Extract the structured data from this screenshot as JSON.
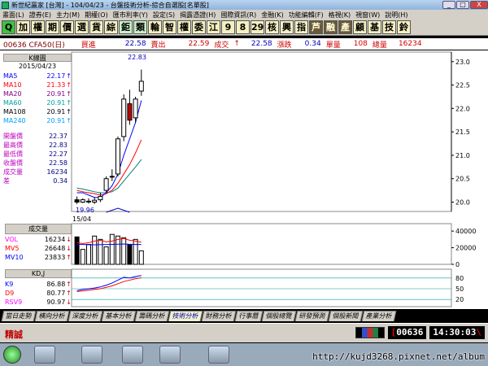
{
  "window": {
    "title": "新世紀贏家 [台灣] - 104/04/23 - 台盤技術分析-綜合自選股[名單股]",
    "min_label": "_",
    "max_label": "□",
    "close_label": "X"
  },
  "menu": [
    "畫面(L)",
    "證券(E)",
    "主力(M)",
    "期權(O)",
    "匯市利率(Y)",
    "設定(S)",
    "揭露憑證(H)",
    "國際資訊(R)",
    "金融(K)",
    "功能編輯(F)",
    "格視(K)",
    "視窗(W)",
    "說明(H)"
  ],
  "toolbar": [
    "加",
    "權",
    "期",
    "價",
    "選",
    "貨",
    "綜",
    "鉅",
    "類",
    "輪",
    "智",
    "權",
    "委",
    "江",
    "9",
    "8",
    "29",
    "核",
    "興",
    "指",
    "芦",
    "融",
    "產",
    "顧",
    "基",
    "技",
    "鈴"
  ],
  "quote": {
    "code": "00636 CFA50(日)",
    "buy_label": "買進",
    "buy": "22.58",
    "sell_label": "賣出",
    "sell": "22.59",
    "trade_label": "成交",
    "trade_arrow": "↑",
    "trade": "22.58",
    "change_label": "漲跌",
    "change": "0.34",
    "volume_label": "單量",
    "volume": "108",
    "total_label": "總量",
    "total": "16234"
  },
  "panel": {
    "header": "K線圖",
    "date": "2015/04/23",
    "ma": [
      {
        "label": "MA5",
        "value": "22.17",
        "arrow": "↑",
        "color": "#0000ff"
      },
      {
        "label": "MA10",
        "value": "21.33",
        "arrow": "↑",
        "color": "#ff0000"
      },
      {
        "label": "MA20",
        "value": "20.91",
        "arrow": "↑",
        "color": "#800080"
      },
      {
        "label": "MA60",
        "value": "20.91",
        "arrow": "↑",
        "color": "#00a0a0"
      },
      {
        "label": "MA108",
        "value": "20.91",
        "arrow": "↑",
        "color": "#000000"
      },
      {
        "label": "MA240",
        "value": "20.91",
        "arrow": "↑",
        "color": "#00a0ff"
      }
    ],
    "stats": [
      {
        "label": "開盤價",
        "value": "22.37"
      },
      {
        "label": "最高價",
        "value": "22.83"
      },
      {
        "label": "最低價",
        "value": "22.27"
      },
      {
        "label": "收盤價",
        "value": "22.58"
      },
      {
        "label": "成交量",
        "value": "16234"
      },
      {
        "label": "差",
        "value": "0.34"
      }
    ]
  },
  "kline": {
    "high_label": "22.83",
    "low_label": "19.96",
    "date_label": "15/04",
    "y_ticks": [
      "23.0",
      "22.5",
      "22.0",
      "21.5",
      "21.0",
      "20.5",
      "20.0"
    ]
  },
  "volume_panel": {
    "header": "成交量",
    "rows": [
      {
        "label": "VOL",
        "value": "16234",
        "arrow": "↓",
        "color": "#ff00ff"
      },
      {
        "label": "MV5",
        "value": "26648",
        "arrow": "↓",
        "color": "#ff0000"
      },
      {
        "label": "MV10",
        "value": "23833",
        "arrow": "↑",
        "color": "#0000ff"
      }
    ],
    "y_ticks": [
      "40000",
      "20000",
      "0"
    ]
  },
  "kd_panel": {
    "header": "KD,J",
    "rows": [
      {
        "label": "K9",
        "value": "86.88",
        "arrow": "↑",
        "color": "#0000ff"
      },
      {
        "label": "D9",
        "value": "80.77",
        "arrow": "↑",
        "color": "#ff0000"
      },
      {
        "label": "RSV9",
        "value": "90.97",
        "arrow": "↓",
        "color": "#ff00ff"
      }
    ],
    "y_ticks": [
      "80",
      "50",
      "20"
    ]
  },
  "tabs": [
    "當日走勢",
    "橫向分析",
    "深度分析",
    "基本分析",
    "籌碼分析",
    "技術分析",
    "財務分析",
    "行事曆",
    "個股總覽",
    "研發預測",
    "個股新聞",
    "產業分析"
  ],
  "active_tab": "技術分析",
  "status": {
    "left": "精誠",
    "code": "00636",
    "time": "14:30:03"
  },
  "watermark": "http://kujd3268.pixnet.net/album",
  "chart_data": {
    "type": "candlestick",
    "candles": [
      {
        "o": 20.05,
        "h": 20.12,
        "l": 19.96,
        "c": 20.0
      },
      {
        "o": 20.0,
        "h": 20.08,
        "l": 19.98,
        "c": 20.05
      },
      {
        "o": 20.02,
        "h": 20.08,
        "l": 19.97,
        "c": 20.02
      },
      {
        "o": 20.0,
        "h": 20.1,
        "l": 19.96,
        "c": 20.04
      },
      {
        "o": 20.05,
        "h": 20.2,
        "l": 20.0,
        "c": 20.12
      },
      {
        "o": 20.25,
        "h": 20.55,
        "l": 20.2,
        "c": 20.5
      },
      {
        "o": 20.55,
        "h": 20.7,
        "l": 20.45,
        "c": 20.55
      },
      {
        "o": 20.6,
        "h": 21.4,
        "l": 20.55,
        "c": 21.35
      },
      {
        "o": 21.4,
        "h": 22.3,
        "l": 21.3,
        "c": 22.2
      },
      {
        "o": 22.1,
        "h": 22.4,
        "l": 21.65,
        "c": 21.75
      },
      {
        "o": 21.8,
        "h": 22.25,
        "l": 21.7,
        "c": 22.2
      },
      {
        "o": 22.37,
        "h": 22.83,
        "l": 22.27,
        "c": 22.58
      }
    ],
    "ma5": [
      20.2,
      20.2,
      20.15,
      20.1,
      20.1,
      20.2,
      20.35,
      20.6,
      21.0,
      21.35,
      21.7,
      22.17
    ],
    "ma10": [
      20.25,
      20.22,
      20.2,
      20.18,
      20.15,
      20.18,
      20.25,
      20.4,
      20.6,
      20.8,
      21.05,
      21.33
    ],
    "ma20": [
      20.3,
      20.28,
      20.25,
      20.22,
      20.2,
      20.2,
      20.22,
      20.3,
      20.45,
      20.6,
      20.75,
      20.91
    ],
    "volume": [
      33000,
      18000,
      24000,
      34000,
      30000,
      21000,
      36000,
      34000,
      32000,
      24000,
      30000,
      16234
    ],
    "mv5": [
      26000,
      25000,
      26000,
      28000,
      29000,
      27000,
      28000,
      30000,
      31000,
      29000,
      28000,
      26648
    ],
    "mv10": [
      24000,
      23800,
      23600,
      23500,
      23700,
      23800,
      24000,
      24200,
      24400,
      24100,
      23900,
      23833
    ],
    "k": [
      45,
      48,
      50,
      52,
      55,
      60,
      66,
      74,
      82,
      80,
      84,
      86.88
    ],
    "d": [
      42,
      44,
      46,
      48,
      50,
      54,
      58,
      64,
      70,
      74,
      78,
      80.77
    ],
    "y_range": [
      19.8,
      23.1
    ],
    "vol_range": [
      0,
      45000
    ],
    "kd_range": [
      0,
      100
    ]
  }
}
